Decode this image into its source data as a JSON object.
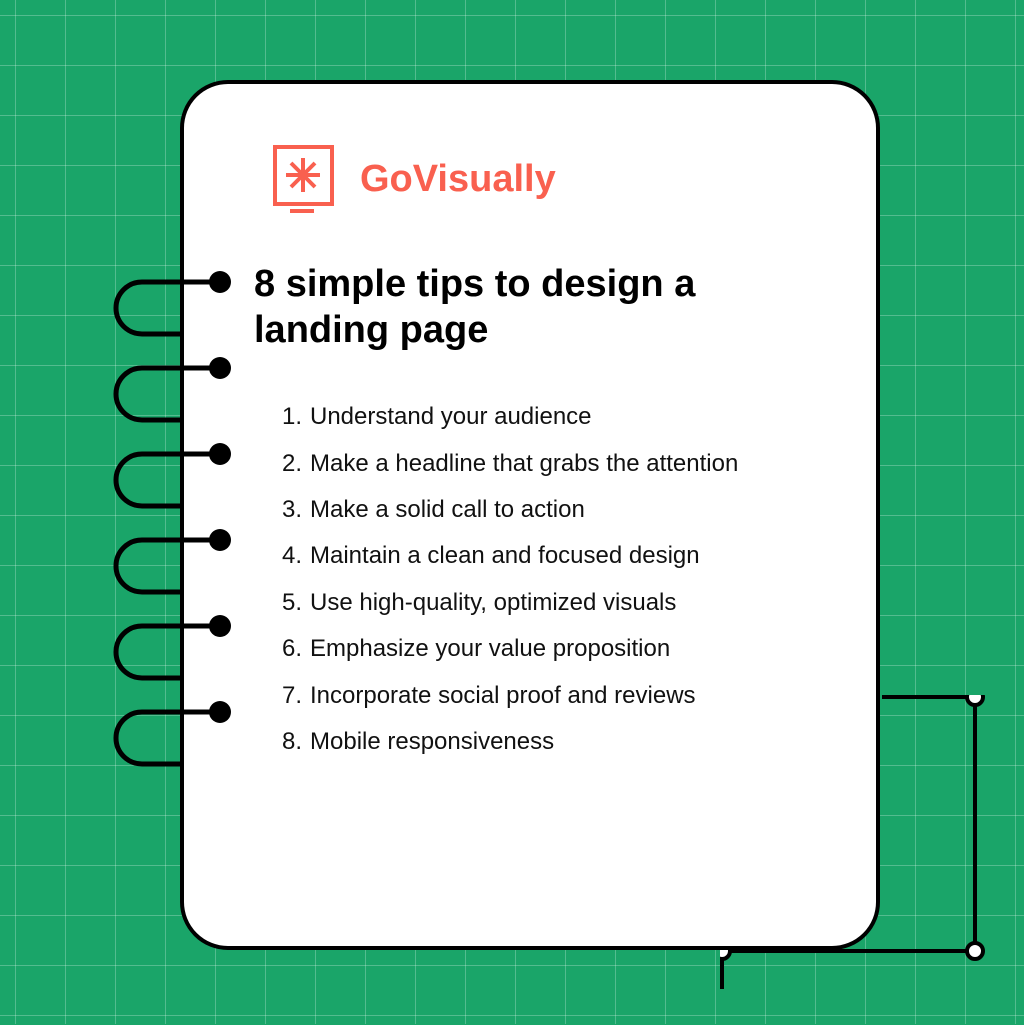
{
  "brand": {
    "name": "GoVisually"
  },
  "title": "8 simple tips to design a landing page",
  "tips": [
    "Understand your audience",
    "Make a headline that grabs the attention",
    "Make a solid call to action",
    "Maintain a clean and focused design",
    "Use high-quality, optimized visuals",
    "Emphasize your value proposition",
    "Incorporate social proof and reviews",
    "Mobile responsiveness"
  ],
  "colors": {
    "background": "#1aa569",
    "accent": "#f9604f"
  }
}
